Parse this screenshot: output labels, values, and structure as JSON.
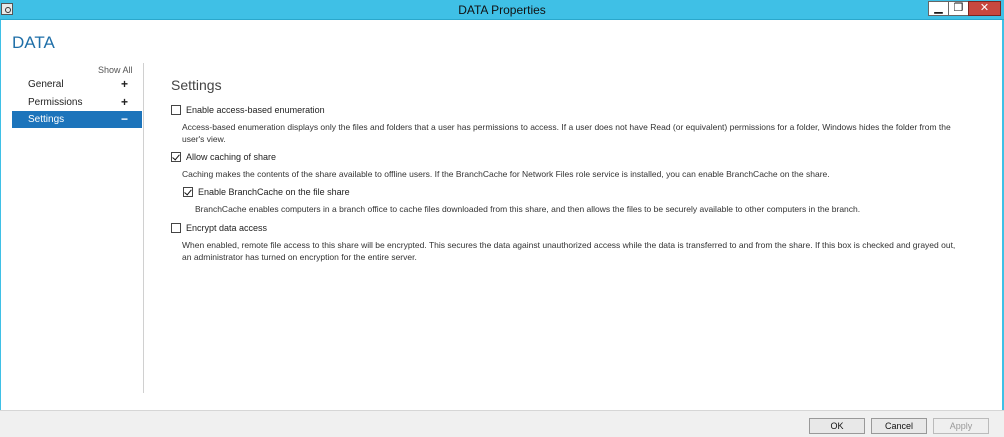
{
  "window": {
    "title": "DATA Properties",
    "minimize_glyph": "▁",
    "maximize_glyph": "❐",
    "close_glyph": "✕"
  },
  "page_title": "DATA",
  "nav": {
    "show_all": "Show All",
    "items": [
      {
        "label": "General",
        "sign": "+"
      },
      {
        "label": "Permissions",
        "sign": "+"
      },
      {
        "label": "Settings",
        "sign": "−"
      }
    ]
  },
  "settings": {
    "title": "Settings",
    "options": [
      {
        "label": "Enable access-based enumeration",
        "checked": false,
        "description_line1": "Access-based enumeration displays only the files and folders that a user has permissions to access. If a user does not have Read (or equivalent) permissions for a folder, Windows hides the folder from the",
        "description_line2": "user's view."
      },
      {
        "label": "Allow caching of share",
        "checked": true,
        "description_line1": "Caching makes the contents of the share available to offline users. If the BranchCache for Network Files role service is installed, you can enable BranchCache on the share."
      },
      {
        "label": "Enable BranchCache on the file share",
        "checked": true,
        "description_line1": "BranchCache enables computers in a branch office to cache files downloaded from this share, and then allows the files to be securely available to other computers in the branch."
      },
      {
        "label": "Encrypt data access",
        "checked": false,
        "description_line1": "When enabled, remote file access to this share will be encrypted. This secures the data against unauthorized access while the data is transferred to and from the share. If this box is checked and grayed out,",
        "description_line2": "an administrator has turned on encryption for the entire server."
      }
    ]
  },
  "buttons": {
    "ok": "OK",
    "cancel": "Cancel",
    "apply": "Apply"
  },
  "colors": {
    "titlebar": "#3fc0e6",
    "accent": "#1c74bb",
    "close": "#c7483f"
  }
}
